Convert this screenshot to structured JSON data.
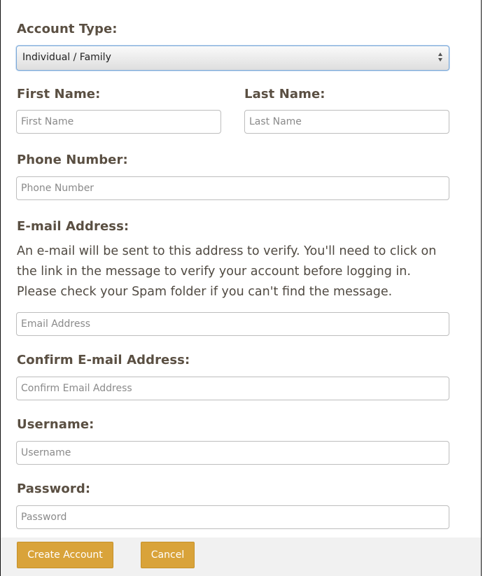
{
  "account_type": {
    "label": "Account Type:",
    "selected": "Individual / Family"
  },
  "first_name": {
    "label": "First Name:",
    "placeholder": "First Name",
    "value": ""
  },
  "last_name": {
    "label": "Last Name:",
    "placeholder": "Last Name",
    "value": ""
  },
  "phone": {
    "label": "Phone Number:",
    "placeholder": "Phone Number",
    "value": ""
  },
  "email": {
    "label": "E-mail Address:",
    "description": "An e-mail will be sent to this address to verify. You'll need to click on the link in the message to verify your account before logging in. Please check your Spam folder if you can't find the message.",
    "placeholder": "Email Address",
    "value": ""
  },
  "confirm_email": {
    "label": "Confirm E-mail Address:",
    "placeholder": "Confirm Email Address",
    "value": ""
  },
  "username": {
    "label": "Username:",
    "placeholder": "Username",
    "value": ""
  },
  "password": {
    "label": "Password:",
    "placeholder": "Password",
    "value": ""
  },
  "buttons": {
    "create": "Create Account",
    "cancel": "Cancel"
  },
  "colors": {
    "button": "#d9a33a",
    "label": "#5a4f42",
    "select_focus": "#7aa8d8"
  }
}
